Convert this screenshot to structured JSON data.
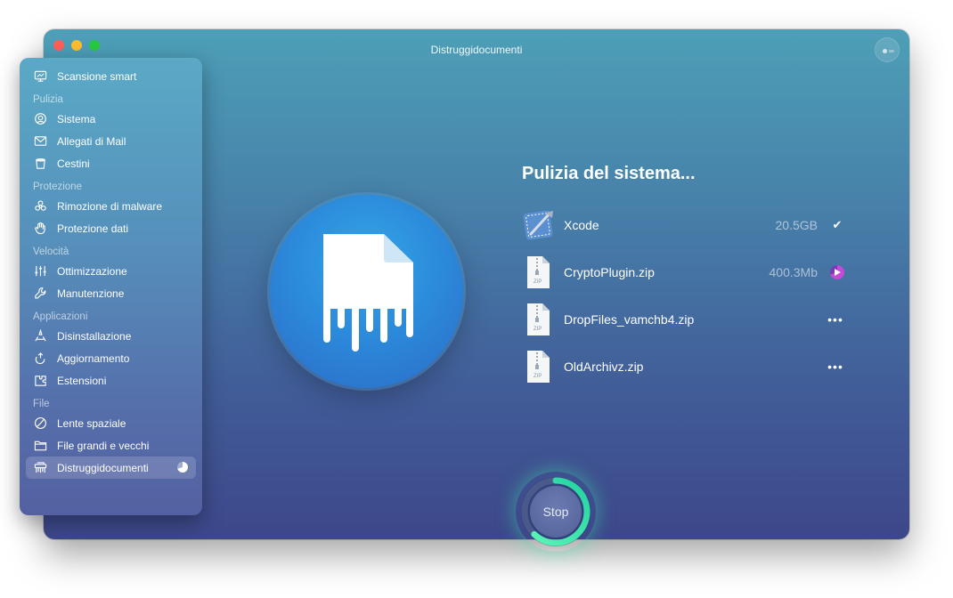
{
  "window": {
    "title": "Distruggidocumenti",
    "traffic_lights": [
      "close",
      "minimize",
      "zoom"
    ],
    "assistant_icon": "assistant-icon"
  },
  "sidebar": {
    "top_item": {
      "label": "Scansione smart",
      "icon": "display-icon"
    },
    "sections": [
      {
        "title": "Pulizia",
        "items": [
          {
            "label": "Sistema",
            "icon": "system-icon"
          },
          {
            "label": "Allegati di Mail",
            "icon": "mail-icon"
          },
          {
            "label": "Cestini",
            "icon": "trash-icon"
          }
        ]
      },
      {
        "title": "Protezione",
        "items": [
          {
            "label": "Rimozione di malware",
            "icon": "biohazard-icon"
          },
          {
            "label": "Protezione dati",
            "icon": "hand-icon"
          }
        ]
      },
      {
        "title": "Velocità",
        "items": [
          {
            "label": "Ottimizzazione",
            "icon": "sliders-icon"
          },
          {
            "label": "Manutenzione",
            "icon": "wrench-icon"
          }
        ]
      },
      {
        "title": "Applicazioni",
        "items": [
          {
            "label": "Disinstallazione",
            "icon": "uninstall-icon"
          },
          {
            "label": "Aggiornamento",
            "icon": "update-icon"
          },
          {
            "label": "Estensioni",
            "icon": "extensions-icon"
          }
        ]
      },
      {
        "title": "File",
        "items": [
          {
            "label": "Lente spaziale",
            "icon": "space-lens-icon"
          },
          {
            "label": "File grandi e vecchi",
            "icon": "folder-icon"
          },
          {
            "label": "Distruggidocumenti",
            "icon": "shredder-icon",
            "active": true,
            "progress": 0.7
          }
        ]
      }
    ]
  },
  "main": {
    "title": "Pulizia del sistema...",
    "files": [
      {
        "name": "Xcode",
        "size": "20.5GB",
        "status": "done",
        "status_glyph": "✔",
        "icon": "xcode-icon"
      },
      {
        "name": "CryptoPlugin.zip",
        "size": "400.3Mb",
        "status": "in-progress",
        "icon": "zip-icon",
        "file_label": "ZIP"
      },
      {
        "name": "DropFiles_vamchb4.zip",
        "size": "",
        "status": "pending",
        "status_glyph": "•••",
        "icon": "zip-icon",
        "file_label": "ZIP"
      },
      {
        "name": "OldArchivz.zip",
        "size": "",
        "status": "pending",
        "status_glyph": "•••",
        "icon": "zip-icon",
        "file_label": "ZIP"
      }
    ],
    "stop_button": {
      "label": "Stop",
      "progress": 0.62
    },
    "colors": {
      "progress_ring_start": "#22d3a0",
      "progress_ring_end": "#5ef7b8",
      "accent_purple": "#c64ad8"
    }
  }
}
